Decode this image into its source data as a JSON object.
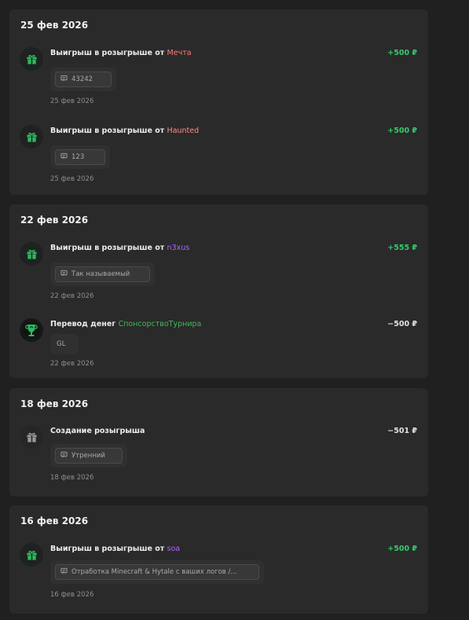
{
  "groups": [
    {
      "date": "25 фев 2026",
      "items": [
        {
          "icon": "gift-icon",
          "title": "Выигрыш в розыгрыше от",
          "who": "Мечта",
          "who_color": "#ff7a7a",
          "amount": "+500 ₽",
          "amount_color": "#35c96a",
          "note": "43242",
          "date": "25 фев 2026"
        },
        {
          "icon": "gift-icon",
          "title": "Выигрыш в розыгрыше от",
          "who": "Haunted",
          "who_color": "#ff8a8a",
          "amount": "+500 ₽",
          "amount_color": "#35c96a",
          "note": "123",
          "date": "25 фев 2026"
        }
      ]
    },
    {
      "date": "22 фев 2026",
      "items": [
        {
          "icon": "gift-icon",
          "title": "Выигрыш в розыгрыше от",
          "who": "n3xus",
          "who_color": "#b061ff",
          "amount": "+555 ₽",
          "amount_color": "#35c96a",
          "note": "Так называемый",
          "date": "22 фев 2026"
        },
        {
          "icon": "trophy-avatar-icon",
          "title": "Перевод денег",
          "who": "СпонсорствоТурнира",
          "who_color": "#3dbb55",
          "amount": "−500 ₽",
          "amount_color": "#e2e2e2",
          "note": "GL",
          "date": "22 фев 2026"
        }
      ]
    },
    {
      "date": "18 фев 2026",
      "items": [
        {
          "icon": "gift-icon",
          "title": "Создание розыгрыша",
          "who": "",
          "who_color": "#ffffff",
          "amount": "−501 ₽",
          "amount_color": "#e2e2e2",
          "note": "Утренний",
          "date": "18 фев 2026"
        }
      ]
    },
    {
      "date": "16 фев 2026",
      "items": [
        {
          "icon": "gift-icon",
          "title": "Выигрыш в розыгрыше от",
          "who": "soa",
          "who_color": "#b061ff",
          "amount": "+500 ₽",
          "amount_color": "#35c96a",
          "note": "Отработка Minecraft & Hytale с ваших логов /...",
          "date": "16 фев 2026"
        }
      ]
    }
  ]
}
